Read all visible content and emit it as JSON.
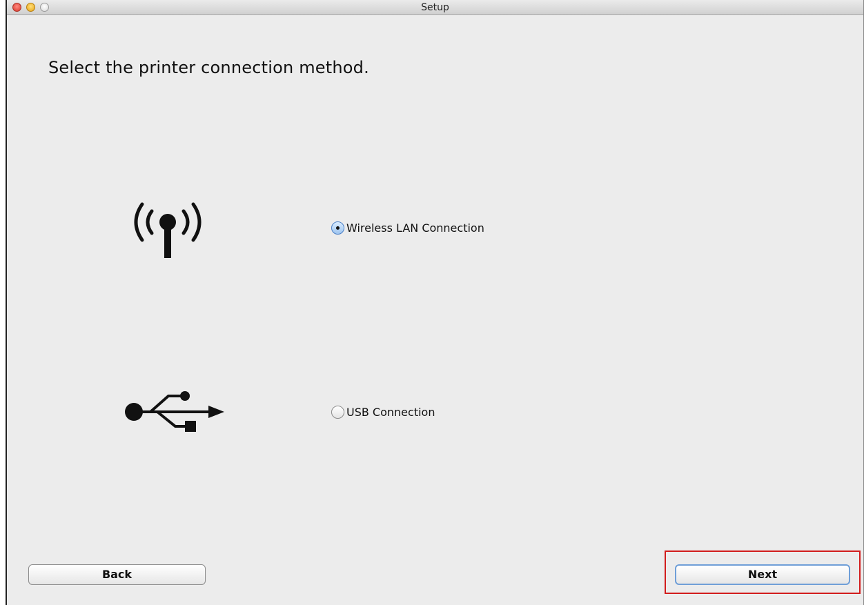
{
  "window": {
    "title": "Setup"
  },
  "page": {
    "heading": "Select the printer connection method."
  },
  "options": [
    {
      "label": "Wireless LAN Connection",
      "icon": "wireless-antenna-icon",
      "selected": true
    },
    {
      "label": "USB Connection",
      "icon": "usb-icon",
      "selected": false
    }
  ],
  "buttons": {
    "back_label": "Back",
    "next_label": "Next"
  },
  "colors": {
    "window_background": "#ececec",
    "highlight_border": "#d21c1c",
    "default_button_border": "#6f9fd8"
  }
}
